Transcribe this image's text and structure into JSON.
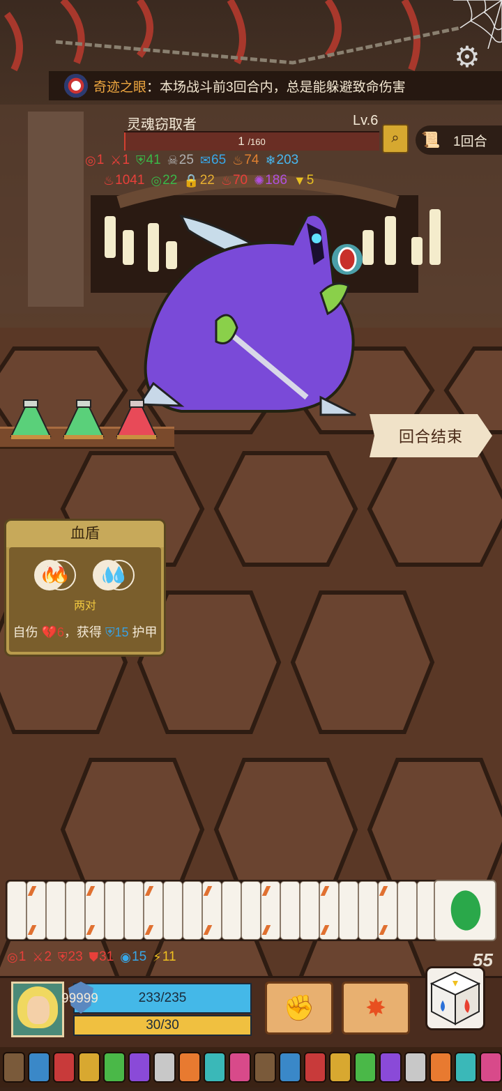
{
  "banner": {
    "blessing_name": "奇迹之眼",
    "blessing_desc": "：本场战斗前3回合内，总是能躲避致命伤害"
  },
  "enemy": {
    "name": "灵魂窃取者",
    "level": "Lv.6",
    "hp_current": "1",
    "hp_max": "/160",
    "hp_fraction": 0.00625,
    "status_row1": [
      {
        "icon": "spiral-icon",
        "value": "1",
        "color": "#e8403a"
      },
      {
        "icon": "broken-sword-icon",
        "value": "1",
        "color": "#e8403a"
      },
      {
        "icon": "green-shield-icon",
        "value": "41",
        "color": "#3ab848"
      },
      {
        "icon": "skull-icon",
        "value": "25",
        "color": "#b0b0b0"
      },
      {
        "icon": "speech-icon",
        "value": "65",
        "color": "#38a8e8"
      },
      {
        "icon": "flame-orange-icon",
        "value": "74",
        "color": "#e08030"
      },
      {
        "icon": "snowflake-icon",
        "value": "203",
        "color": "#48b8f0"
      }
    ],
    "status_row2": [
      {
        "icon": "red-fire-icon",
        "value": "1041",
        "color": "#e8403a"
      },
      {
        "icon": "green-spiral-icon",
        "value": "22",
        "color": "#3ab848"
      },
      {
        "icon": "lock-icon",
        "value": "22",
        "color": "#e8b030"
      },
      {
        "icon": "burn-icon",
        "value": "70",
        "color": "#e8403a"
      },
      {
        "icon": "splat-icon",
        "value": "186",
        "color": "#b050e0"
      },
      {
        "icon": "triangle-icon",
        "value": "5",
        "color": "#e8c020"
      }
    ]
  },
  "round": {
    "label": "1回合"
  },
  "end_turn": {
    "label": "回合结束"
  },
  "skill": {
    "title": "血盾",
    "pair_label": "两对",
    "desc_prefix": "自伤",
    "desc_dmg": "6",
    "desc_mid": "，获得",
    "desc_armor": "15",
    "desc_suffix": "护甲"
  },
  "player_stats": [
    {
      "icon": "spiral-icon",
      "value": "1",
      "color": "#e8403a"
    },
    {
      "icon": "broken-sword-icon",
      "value": "2",
      "color": "#e8403a"
    },
    {
      "icon": "shield-icon",
      "value": "23",
      "color": "#e8403a"
    },
    {
      "icon": "target-shield-icon",
      "value": "31",
      "color": "#e8403a"
    },
    {
      "icon": "ring-icon",
      "value": "15",
      "color": "#38a8e8"
    },
    {
      "icon": "lightning-icon",
      "value": "11",
      "color": "#f0c020"
    }
  ],
  "deck_count": "55",
  "player": {
    "armor": "99999",
    "hp": "233/235",
    "energy": "30/30"
  }
}
